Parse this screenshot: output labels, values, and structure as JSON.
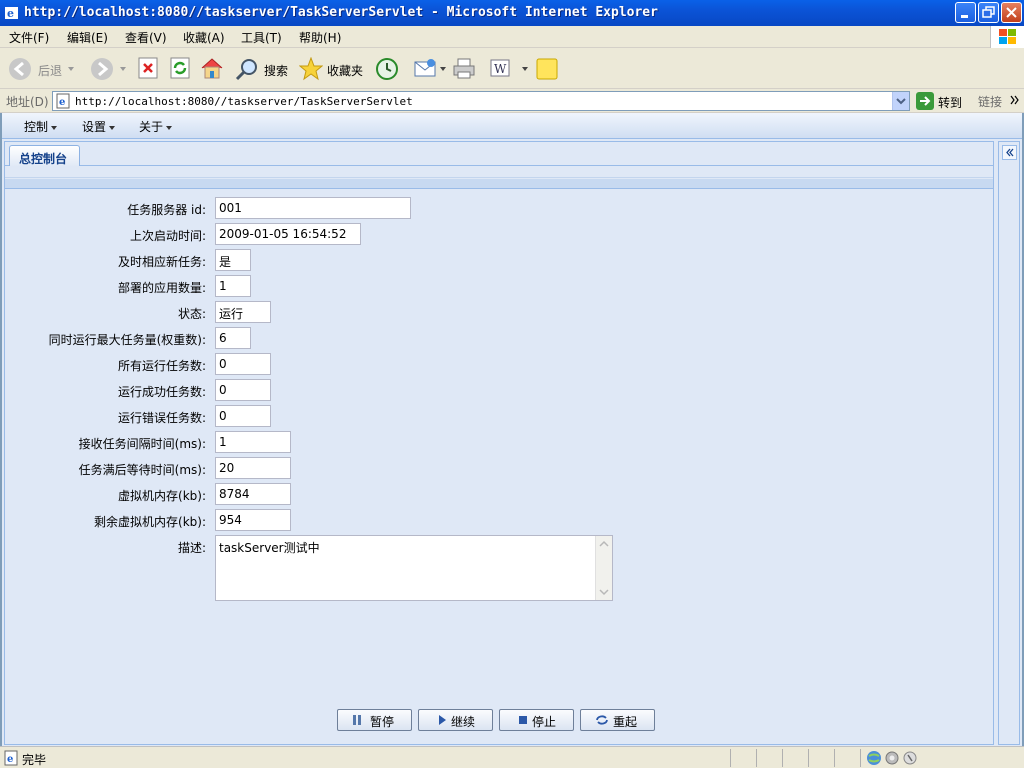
{
  "window": {
    "title": "http://localhost:8080//taskserver/TaskServerServlet - Microsoft Internet Explorer"
  },
  "menubar": {
    "items": [
      "文件(F)",
      "编辑(E)",
      "查看(V)",
      "收藏(A)",
      "工具(T)",
      "帮助(H)"
    ]
  },
  "toolbar": {
    "back_label": "后退",
    "search_label": "搜索",
    "favorites_label": "收藏夹"
  },
  "addressbar": {
    "label": "地址(D)",
    "url": "http://localhost:8080//taskserver/TaskServerServlet",
    "go_label": "转到",
    "links_label": "链接"
  },
  "app_menu": {
    "items": [
      "控制",
      "设置",
      "关于"
    ]
  },
  "tab": {
    "label": "总控制台"
  },
  "form": {
    "fields": [
      {
        "label": "任务服务器 id:",
        "value": "001"
      },
      {
        "label": "上次启动时间:",
        "value": "2009-01-05 16:54:52"
      },
      {
        "label": "及时相应新任务:",
        "value": "是"
      },
      {
        "label": "部署的应用数量:",
        "value": "1"
      },
      {
        "label": "状态:",
        "value": "运行"
      },
      {
        "label": "同时运行最大任务量(权重数):",
        "value": "6"
      },
      {
        "label": "所有运行任务数:",
        "value": "0"
      },
      {
        "label": "运行成功任务数:",
        "value": "0"
      },
      {
        "label": "运行错误任务数:",
        "value": "0"
      },
      {
        "label": "接收任务间隔时间(ms):",
        "value": "1"
      },
      {
        "label": "任务满后等待时间(ms):",
        "value": "20"
      },
      {
        "label": "虚拟机内存(kb):",
        "value": "8784"
      },
      {
        "label": "剩余虚拟机内存(kb):",
        "value": "954"
      }
    ],
    "description_label": "描述:",
    "description_value": "taskServer测试中"
  },
  "actions": {
    "pause_label": "暂停",
    "resume_label": "继续",
    "stop_label": "停止",
    "restart_label": "重起"
  },
  "status": {
    "text": "完毕"
  },
  "colors": {
    "titlebar": "#0b53d6",
    "panel_bg": "#dfe8f6",
    "panel_border": "#99bbe8",
    "tab_text": "#15428b"
  }
}
